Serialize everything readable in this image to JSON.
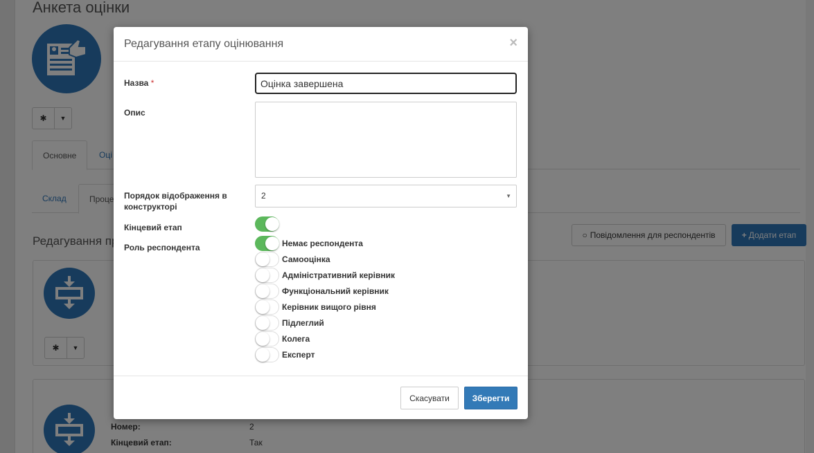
{
  "page": {
    "title": "Анкета оцінки",
    "tabs_main": [
      "Основне",
      "Оці"
    ],
    "tabs_sub": [
      "Склад",
      "Проце"
    ],
    "section_title": "Редагування пр",
    "btn_messages": "Повідомлення для респондентів",
    "btn_add_stage": "Додати етап",
    "card2": {
      "number_label": "Номер:",
      "number_value": "2",
      "final_label": "Кінцевий етап:",
      "final_value": "Так"
    }
  },
  "modal": {
    "title": "Редагування етапу оцінювання",
    "close": "×",
    "name_label": "Назва",
    "required_mark": "*",
    "name_value": "Оцінка завершена",
    "description_label": "Опис",
    "description_value": "",
    "order_label": "Порядок відображення в конструкторі",
    "order_value": "2",
    "select_arrow": "▼",
    "final_stage_label": "Кінцевий етап",
    "final_stage_on": true,
    "role_label": "Роль респондента",
    "roles": [
      {
        "label": "Немає респондента",
        "on": true
      },
      {
        "label": "Самооцінка",
        "on": false
      },
      {
        "label": "Адміністративний керівник",
        "on": false
      },
      {
        "label": "Функціональний керівник",
        "on": false
      },
      {
        "label": "Керівник вищого рівня",
        "on": false
      },
      {
        "label": "Підлеглий",
        "on": false
      },
      {
        "label": "Колега",
        "on": false
      },
      {
        "label": "Експерт",
        "on": false
      }
    ],
    "cancel_label": "Скасувати",
    "save_label": "Зберегти"
  },
  "colors": {
    "primary": "#337ab7",
    "toggle_on": "#5cb85c",
    "required": "#cc3333"
  },
  "icons": [
    "gear-icon",
    "caret-down-icon",
    "comment-icon",
    "plus-icon",
    "close-icon",
    "stage-icon",
    "survey-icon"
  ]
}
